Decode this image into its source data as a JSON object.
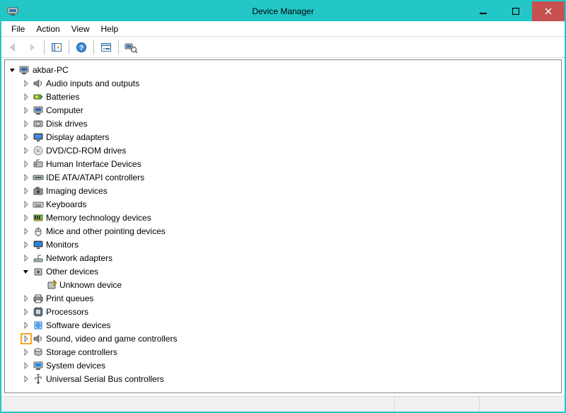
{
  "window": {
    "title": "Device Manager"
  },
  "menu": {
    "items": [
      "File",
      "Action",
      "View",
      "Help"
    ]
  },
  "toolbar": {
    "buttons": [
      {
        "name": "back-button",
        "icon": "arrow-left-icon"
      },
      {
        "name": "forward-button",
        "icon": "arrow-right-icon"
      },
      {
        "sep": true
      },
      {
        "name": "show-hidden-button",
        "icon": "panel-icon"
      },
      {
        "sep": true
      },
      {
        "name": "help-button",
        "icon": "help-icon"
      },
      {
        "sep": true
      },
      {
        "name": "properties-button",
        "icon": "properties-icon"
      },
      {
        "sep": true
      },
      {
        "name": "scan-button",
        "icon": "scan-icon"
      }
    ]
  },
  "tree": {
    "root": {
      "label": "akbar-PC",
      "icon": "computer-root-icon",
      "expanded": true,
      "children": [
        {
          "label": "Audio inputs and outputs",
          "icon": "speaker-icon",
          "expanded": false,
          "children": []
        },
        {
          "label": "Batteries",
          "icon": "battery-icon",
          "expanded": false,
          "children": []
        },
        {
          "label": "Computer",
          "icon": "computer-icon",
          "expanded": false,
          "children": []
        },
        {
          "label": "Disk drives",
          "icon": "disk-icon",
          "expanded": false,
          "children": []
        },
        {
          "label": "Display adapters",
          "icon": "display-icon",
          "expanded": false,
          "children": []
        },
        {
          "label": "DVD/CD-ROM drives",
          "icon": "dvd-icon",
          "expanded": false,
          "children": []
        },
        {
          "label": "Human Interface Devices",
          "icon": "hid-icon",
          "expanded": false,
          "children": []
        },
        {
          "label": "IDE ATA/ATAPI controllers",
          "icon": "ide-icon",
          "expanded": false,
          "children": []
        },
        {
          "label": "Imaging devices",
          "icon": "camera-icon",
          "expanded": false,
          "children": []
        },
        {
          "label": "Keyboards",
          "icon": "keyboard-icon",
          "expanded": false,
          "children": []
        },
        {
          "label": "Memory technology devices",
          "icon": "memory-icon",
          "expanded": false,
          "children": []
        },
        {
          "label": "Mice and other pointing devices",
          "icon": "mouse-icon",
          "expanded": false,
          "children": []
        },
        {
          "label": "Monitors",
          "icon": "monitor-icon",
          "expanded": false,
          "children": []
        },
        {
          "label": "Network adapters",
          "icon": "network-icon",
          "expanded": false,
          "children": []
        },
        {
          "label": "Other devices",
          "icon": "other-icon",
          "expanded": true,
          "children": [
            {
              "label": "Unknown device",
              "icon": "unknown-icon"
            }
          ]
        },
        {
          "label": "Print queues",
          "icon": "printer-icon",
          "expanded": false,
          "children": []
        },
        {
          "label": "Processors",
          "icon": "cpu-icon",
          "expanded": false,
          "children": []
        },
        {
          "label": "Software devices",
          "icon": "software-icon",
          "expanded": false,
          "children": []
        },
        {
          "label": "Sound, video and game controllers",
          "icon": "speaker-icon",
          "expanded": false,
          "children": [],
          "highlight": true
        },
        {
          "label": "Storage controllers",
          "icon": "storage-icon",
          "expanded": false,
          "children": []
        },
        {
          "label": "System devices",
          "icon": "system-icon",
          "expanded": false,
          "children": []
        },
        {
          "label": "Universal Serial Bus controllers",
          "icon": "usb-icon",
          "expanded": false,
          "children": []
        }
      ]
    }
  }
}
